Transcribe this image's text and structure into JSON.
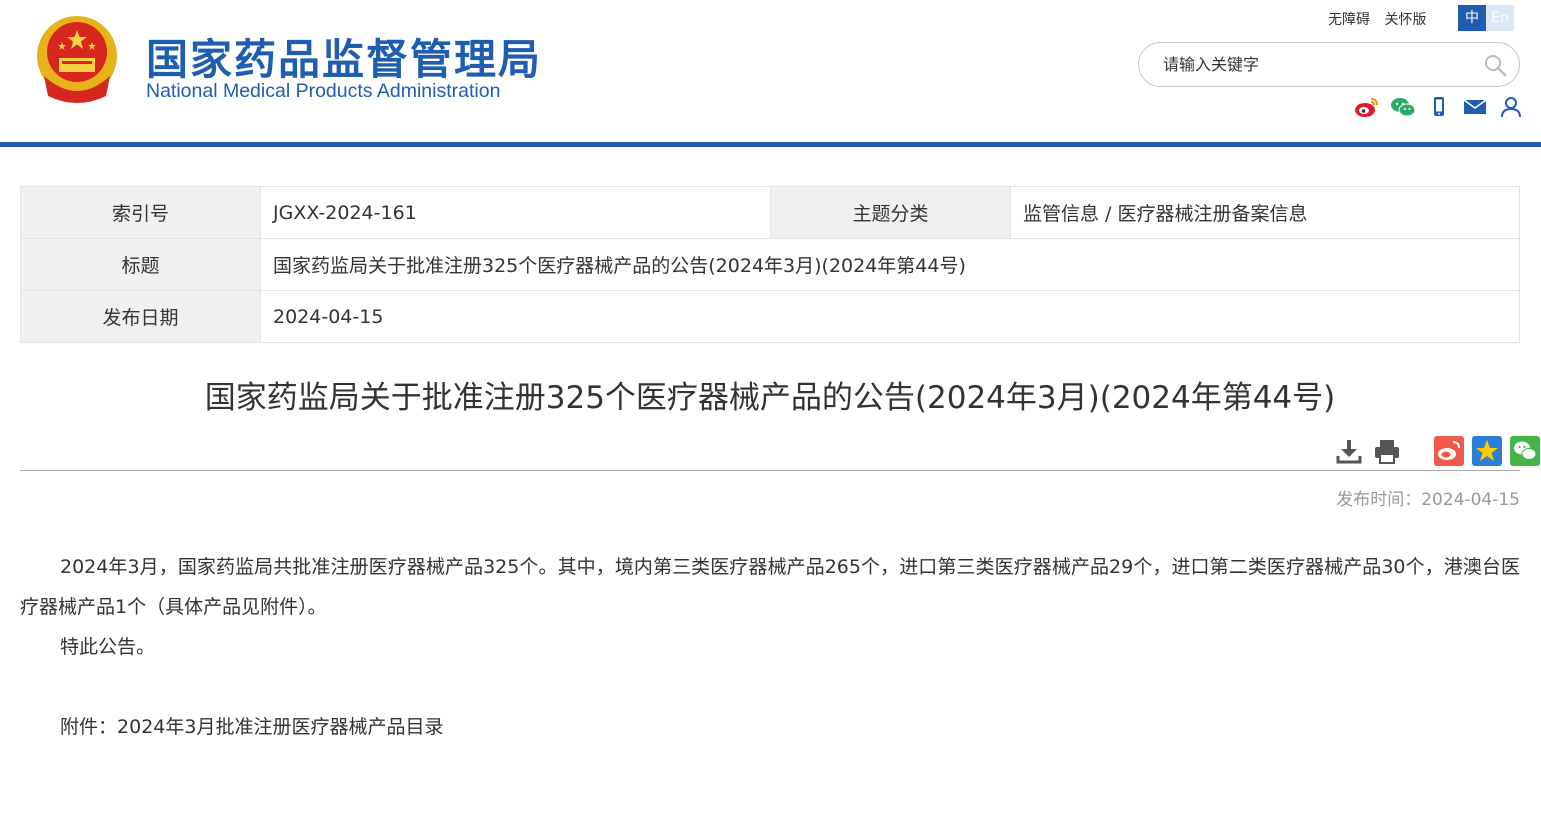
{
  "header": {
    "site_title_cn": "国家药品监督管理局",
    "site_title_en": "National Medical Products Administration",
    "top_links": [
      "无障碍",
      "关怀版"
    ],
    "lang_zh": "中",
    "lang_en": "En",
    "search_placeholder": "请输入关键字",
    "social_icons": [
      "weibo-icon",
      "wechat-icon",
      "mobile-icon",
      "mail-icon",
      "user-icon"
    ],
    "colors": {
      "brand_blue": "#1f5db0",
      "bar_blue": "#2a5db0"
    }
  },
  "info_table": {
    "index_label": "索引号",
    "index_value": "JGXX-2024-161",
    "category_label": "主题分类",
    "category_value": "监管信息 / 医疗器械注册备案信息",
    "title_label": "标题",
    "title_value": "国家药监局关于批准注册325个医疗器械产品的公告(2024年3月)(2024年第44号)",
    "date_label": "发布日期",
    "date_value": "2024-04-15"
  },
  "article": {
    "title": "国家药监局关于批准注册325个医疗器械产品的公告(2024年3月)(2024年第44号)",
    "pub_time": "发布时间：2024-04-15",
    "paragraph1": "2024年3月，国家药监局共批准注册医疗器械产品325个。其中，境内第三类医疗器械产品265个，进口第三类医疗器械产品29个，进口第二类医疗器械产品30个，港澳台医疗器械产品1个（具体产品见附件）。",
    "paragraph2": "特此公告。",
    "attachment_label": "附件：",
    "attachment_link": "2024年3月批准注册医疗器械产品目录"
  }
}
